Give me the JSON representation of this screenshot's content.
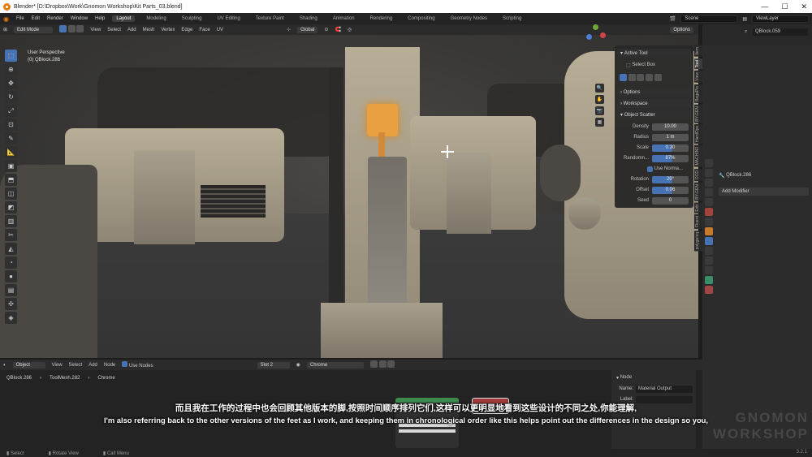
{
  "window": {
    "title": "Blender* [D:\\Dropbox\\Work\\Gnomon Workshop\\Kit Parts_03.blend]",
    "controls": [
      "—",
      "☐",
      "✕"
    ]
  },
  "menubar": {
    "menus": [
      "File",
      "Edit",
      "Render",
      "Window",
      "Help"
    ],
    "workspaces": [
      "Layout",
      "Modeling",
      "Sculpting",
      "UV Editing",
      "Texture Paint",
      "Shading",
      "Animation",
      "Rendering",
      "Compositing",
      "Geometry Nodes",
      "Scripting"
    ],
    "active_workspace": "Layout",
    "scene": "Scene",
    "view_layer": "ViewLayer"
  },
  "viewport_header": {
    "mode": "Edit Mode",
    "menus": [
      "View",
      "Select",
      "Add",
      "Mesh",
      "Vertex",
      "Edge",
      "Face",
      "UV"
    ],
    "orientation": "Global",
    "options": "Options"
  },
  "viewport": {
    "perspective": "User Perspective",
    "object": "(0) QBlock.286"
  },
  "npanel": {
    "active_tool_header": "Active Tool",
    "active_tool": "Select Box",
    "sections": [
      "Options",
      "Workspace",
      "Object Scatter"
    ],
    "fields": [
      {
        "label": "Density",
        "value": "10.00"
      },
      {
        "label": "Radius",
        "value": "1 m"
      },
      {
        "label": "Scale",
        "value": "0.30"
      },
      {
        "label": "Randomn...",
        "value": "87%"
      }
    ],
    "checkbox": "Use Norma...",
    "fields2": [
      {
        "label": "Rotation",
        "value": "29°"
      },
      {
        "label": "Offset",
        "value": "0.06"
      },
      {
        "label": "Seed",
        "value": "0"
      }
    ],
    "tabs": [
      "Item",
      "Tool",
      "View",
      "BagaPie",
      "BY-GEN",
      "HardOps",
      "MACHIN3",
      "OCD",
      "BY-GEN",
      "Edit",
      "Fluent",
      "polygoniq"
    ]
  },
  "outliner": {
    "search_value": "QBlock.059"
  },
  "properties": {
    "object_name": "QBlock.286",
    "add_modifier": "Add Modifier"
  },
  "shader_header": {
    "type": "Object",
    "menus": [
      "View",
      "Select",
      "Add",
      "Node"
    ],
    "use_nodes": "Use Nodes",
    "slot": "Slot 2",
    "material": "Chrome"
  },
  "breadcrumb": [
    "QBlock.286",
    "ToolMesh.282",
    "Chrome"
  ],
  "node_panel": {
    "header": "Node",
    "name_label": "Name:",
    "name_value": "Material Output",
    "label_label": "Label:"
  },
  "statusbar": {
    "items": [
      "Select",
      "Rotate View",
      "Call Menu"
    ],
    "version": "3.2.1"
  },
  "subtitles": {
    "chinese": "而且我在工作的过程中也会回顾其他版本的脚,按照时间顺序排列它们,这样可以更明显地看到这些设计的不同之处,你能理解,",
    "english": "I'm also referring back to the other versions of the feet as I work, and keeping them in chronological order like this helps point out the differences in the design so you,"
  },
  "watermark": [
    "GNOMON",
    "WORKSHOP"
  ],
  "colors": {
    "accent": "#4772b3",
    "selection": "#e8a040",
    "blender_orange": "#e87d0d"
  }
}
